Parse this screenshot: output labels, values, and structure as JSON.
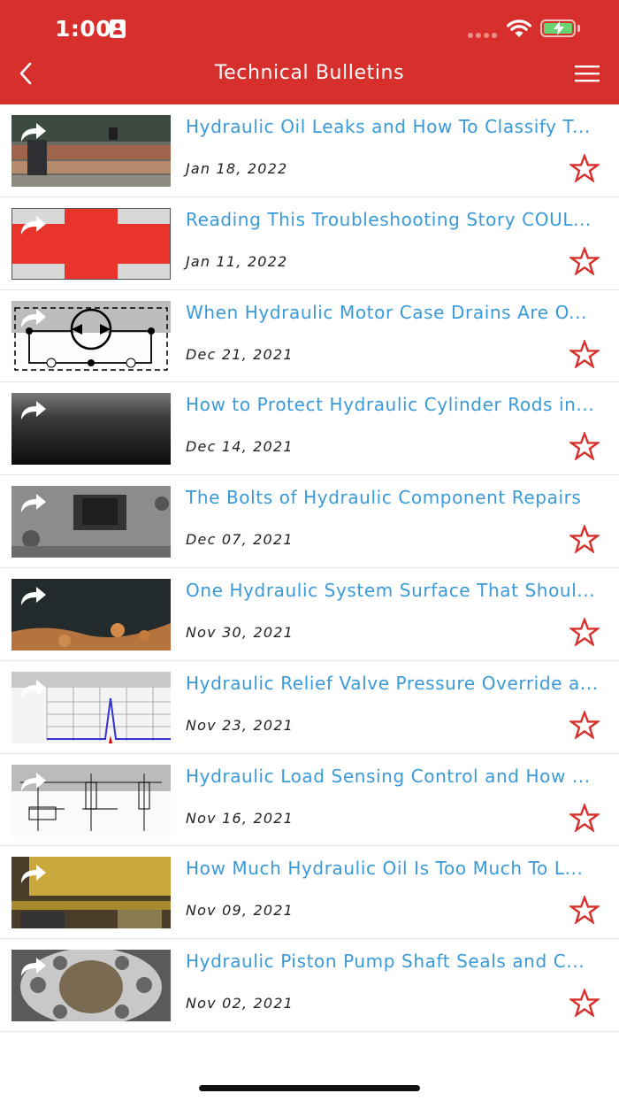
{
  "status_bar": {
    "time": "1:00"
  },
  "header": {
    "title": "Technical Bulletins"
  },
  "colors": {
    "brand": "#d7302c",
    "link": "#3a9ad9",
    "star": "#d7302c"
  },
  "bulletins": [
    {
      "title": "Hydraulic Oil Leaks and How To Classify T...",
      "date": "Jan 18, 2022",
      "thumbnail": "pipes-photo"
    },
    {
      "title": "Reading This Troubleshooting Story COUL...",
      "date": "Jan 11, 2022",
      "thumbnail": "red-cross-diagram"
    },
    {
      "title": "When Hydraulic Motor Case Drains Are O...",
      "date": "Dec 21, 2021",
      "thumbnail": "motor-schematic"
    },
    {
      "title": "How to Protect Hydraulic Cylinder Rods in...",
      "date": "Dec 14, 2021",
      "thumbnail": "cylinder-rod-photo"
    },
    {
      "title": "The Bolts of Hydraulic Component Repairs",
      "date": "Dec 07, 2021",
      "thumbnail": "component-photo"
    },
    {
      "title": "One Hydraulic System Surface That Shoul...",
      "date": "Nov 30, 2021",
      "thumbnail": "rusted-surface-photo"
    },
    {
      "title": "Hydraulic Relief Valve Pressure Override a...",
      "date": "Nov 23, 2021",
      "thumbnail": "pressure-graph"
    },
    {
      "title": "Hydraulic Load Sensing Control and How ...",
      "date": "Nov 16, 2021",
      "thumbnail": "load-sensing-schematic"
    },
    {
      "title": "How Much Hydraulic Oil Is Too Much To L...",
      "date": "Nov 09, 2021",
      "thumbnail": "machine-photo"
    },
    {
      "title": "Hydraulic Piston Pump Shaft Seals and C...",
      "date": "Nov 02, 2021",
      "thumbnail": "piston-pump-photo"
    }
  ]
}
